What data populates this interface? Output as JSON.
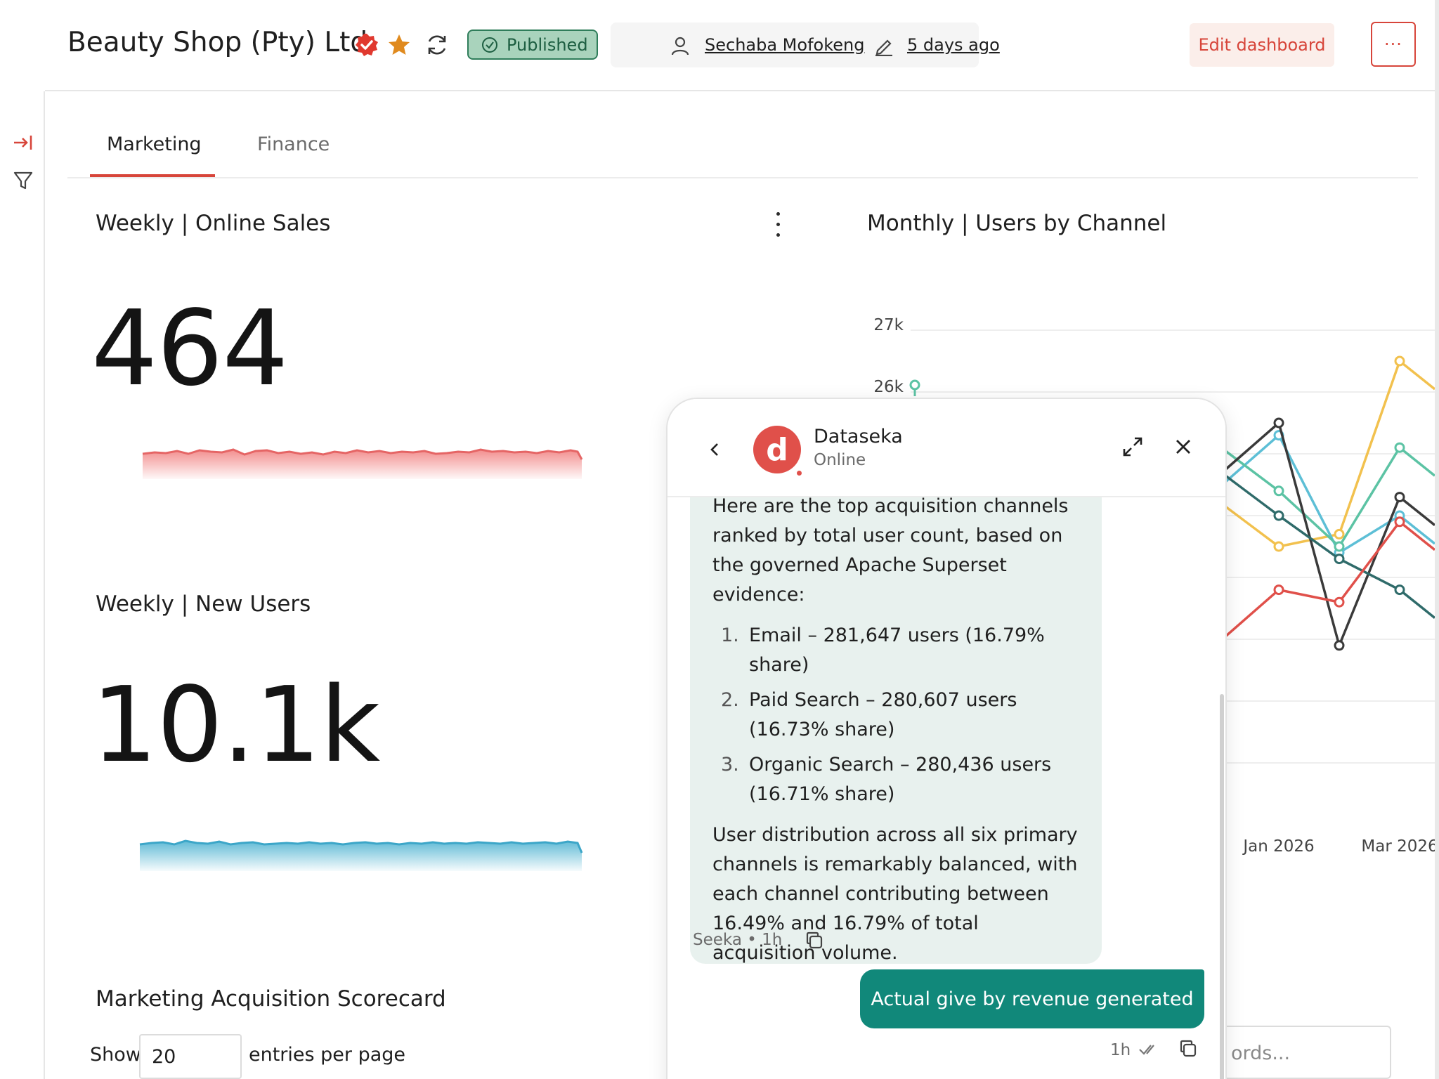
{
  "header": {
    "title": "Beauty Shop (Pty) Ltd",
    "status_badge": "Published",
    "owner": "Sechaba Mofokeng",
    "modified": "5 days ago",
    "edit_label": "Edit dashboard",
    "more_label": "···"
  },
  "tabs": [
    {
      "label": "Marketing",
      "active": true
    },
    {
      "label": "Finance",
      "active": false
    }
  ],
  "cards": {
    "online_sales": {
      "title": "Weekly | Online Sales",
      "value": "464"
    },
    "new_users": {
      "title": "Weekly | New Users",
      "value": "10.1k"
    },
    "users_by_channel": {
      "title": "Monthly | Users by Channel"
    },
    "scorecard": {
      "title": "Marketing Acquisition Scorecard"
    }
  },
  "table_controls": {
    "show_label": "Show",
    "page_size": "20",
    "suffix": "entries per page",
    "search_placeholder": "ords..."
  },
  "chart_data": {
    "type": "line",
    "title": "Monthly | Users by Channel",
    "y_ticks": [
      "27k",
      "26k"
    ],
    "x_ticks": [
      "Jan 2026",
      "Mar 2026"
    ],
    "series": [
      {
        "color": "#f2c14e",
        "values": [
          {
            "x": "Jan 2026",
            "y": 23.5
          },
          {
            "x": "Feb 2026",
            "y": 23.7
          },
          {
            "x": "Mar 2026",
            "y": 26.5
          }
        ]
      },
      {
        "color": "#5dbfd6",
        "values": [
          {
            "x": "Jan 2026",
            "y": 25.3
          },
          {
            "x": "Feb 2026",
            "y": 23.4
          },
          {
            "x": "Mar 2026",
            "y": 24.0
          }
        ]
      },
      {
        "color": "#5cc3a4",
        "values": [
          {
            "x": "Jan 2026",
            "y": 24.4
          },
          {
            "x": "Feb 2026",
            "y": 23.5
          },
          {
            "x": "Mar 2026",
            "y": 25.1
          }
        ]
      },
      {
        "color": "#3a3a3a",
        "values": [
          {
            "x": "Jan 2026",
            "y": 25.5
          },
          {
            "x": "Feb 2026",
            "y": 21.9
          },
          {
            "x": "Mar 2026",
            "y": 24.3
          }
        ]
      },
      {
        "color": "#2f6b6a",
        "values": [
          {
            "x": "Jan 2026",
            "y": 24.0
          },
          {
            "x": "Feb 2026",
            "y": 23.3
          },
          {
            "x": "Mar 2026",
            "y": 22.8
          }
        ]
      },
      {
        "color": "#e0504a",
        "values": [
          {
            "x": "Jan 2026",
            "y": 22.8
          },
          {
            "x": "Feb 2026",
            "y": 22.6
          },
          {
            "x": "Mar 2026",
            "y": 23.9
          }
        ]
      }
    ],
    "visible_point": {
      "color": "#5cc3a4",
      "y": 26.0
    }
  },
  "chat": {
    "bot_name": "Dataseka",
    "bot_status": "Online",
    "avatar_letter": "d",
    "intro": "Here are the top acquisition channels ranked by total user count, based on the governed Apache Superset evidence:",
    "items": [
      {
        "num": "1.",
        "text": "Email – 281,647 users (16.79% share)"
      },
      {
        "num": "2.",
        "text": "Paid Search – 280,607 users (16.73% share)"
      },
      {
        "num": "3.",
        "text": "Organic Search – 280,436 users (16.71% share)"
      }
    ],
    "summary": "User distribution across all six primary channels is remarkably balanced, with each channel contributing between 16.49% and 16.79% of total acquisition volume.",
    "bot_meta": "Seeka  •  1h",
    "user_message": "Actual give by revenue generated",
    "user_meta": "1h"
  },
  "colors": {
    "accent": "#d7453a",
    "teal": "#11887a",
    "sparkline_red": "#f08d8d",
    "sparkline_blue": "#4fb3d1"
  }
}
